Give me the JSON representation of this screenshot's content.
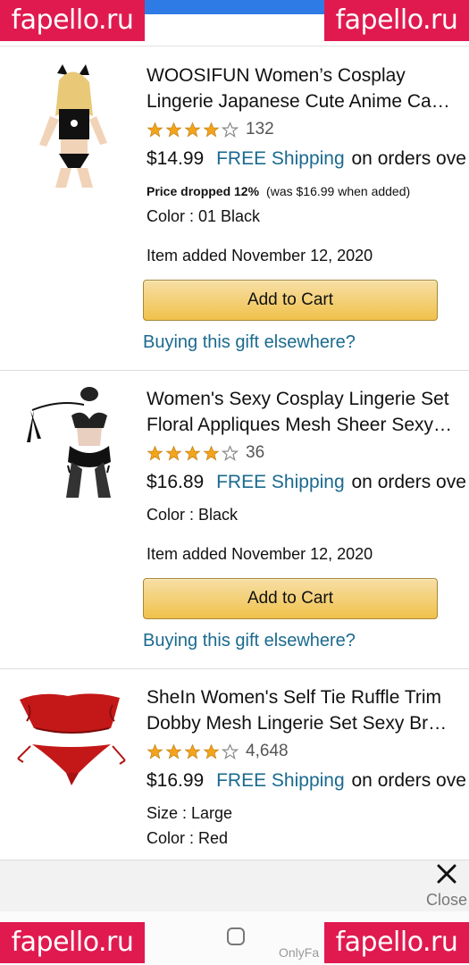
{
  "watermark": "fapello.ru",
  "bottom_watermark_text": "OnlyFa",
  "close_label": "Close",
  "items": [
    {
      "title_lines": [
        "WOOSIFUN Women’s Cosplay",
        "Lingerie Japanese Cute Anime Cat…"
      ],
      "rating": 4.5,
      "rating_count": "132",
      "price": "$14.99",
      "free_shipping": "FREE Shipping",
      "orders_text": "on orders ove",
      "price_dropped": "Price dropped 12%",
      "was_text": "(was $16.99 when added)",
      "color": "Color : 01 Black",
      "added": "Item added November 12, 2020",
      "add_to_cart": "Add to Cart",
      "gift": "Buying this gift elsewhere?"
    },
    {
      "title_lines": [
        "Women's Sexy Cosplay Lingerie Set",
        "Floral Appliques Mesh Sheer Sexy…"
      ],
      "rating": 4.5,
      "rating_count": "36",
      "price": "$16.89",
      "free_shipping": "FREE Shipping",
      "orders_text": "on orders ove",
      "color": "Color : Black",
      "added": "Item added November 12, 2020",
      "add_to_cart": "Add to Cart",
      "gift": "Buying this gift elsewhere?"
    },
    {
      "title_lines": [
        "SheIn Women's Self Tie Ruffle Trim",
        "Dobby Mesh Lingerie Set Sexy Br…"
      ],
      "rating": 4.5,
      "rating_count": "4,648",
      "price": "$16.99",
      "free_shipping": "FREE Shipping",
      "orders_text": "on orders ove",
      "size": "Size : Large",
      "color": "Color : Red"
    }
  ],
  "colors": {
    "link": "#1a6a8f",
    "star": "#f4a41c",
    "button": "#f0c14b",
    "watermark": "#e01a4f"
  }
}
